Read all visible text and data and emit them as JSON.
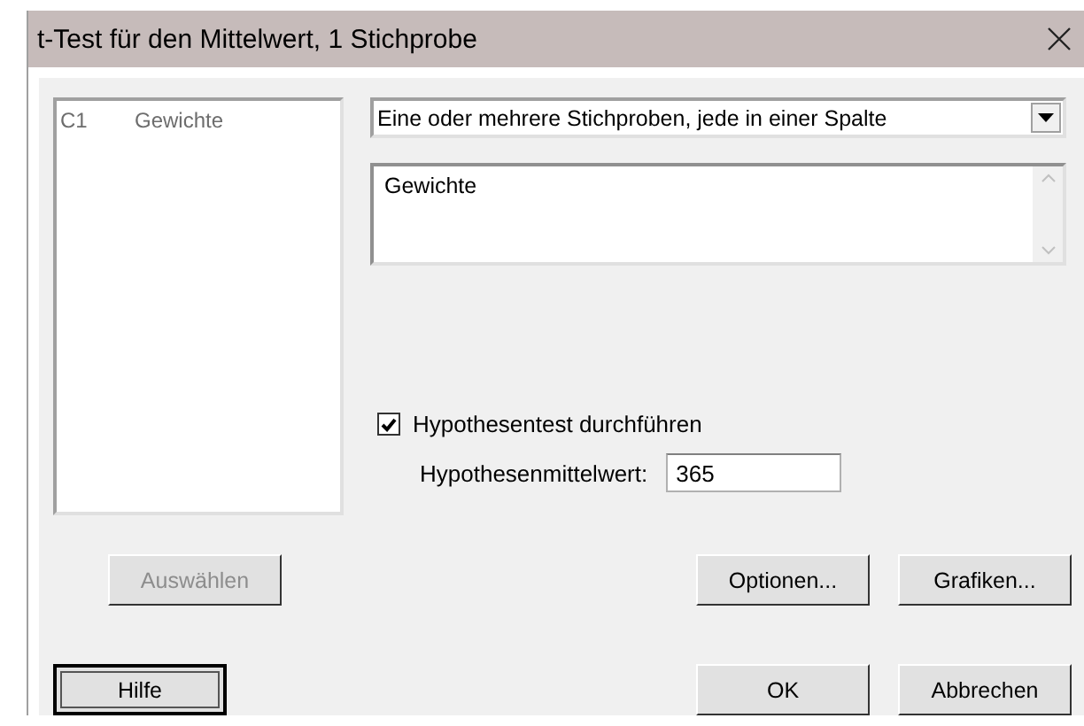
{
  "window": {
    "title": "t-Test für den Mittelwert, 1 Stichprobe"
  },
  "column_list": {
    "items": [
      {
        "column": "C1",
        "name": "Gewichte"
      }
    ]
  },
  "sample_type": {
    "value": "Eine oder mehrere Stichproben, jede in einer Spalte"
  },
  "variables": {
    "value": "Gewichte"
  },
  "hypothesis_test": {
    "label": "Hypothesentest durchführen",
    "checked": true
  },
  "hypothesized_mean": {
    "label": "Hypothesenmittelwert:",
    "value": "365"
  },
  "select_button": {
    "label": "Auswählen",
    "disabled": true
  },
  "options_button": {
    "label": "Optionen..."
  },
  "graphs_button": {
    "label": "Grafiken..."
  },
  "help_button": {
    "label": "Hilfe",
    "focused": true
  },
  "ok_button": {
    "label": "OK"
  },
  "cancel_button": {
    "label": "Abbrechen"
  }
}
